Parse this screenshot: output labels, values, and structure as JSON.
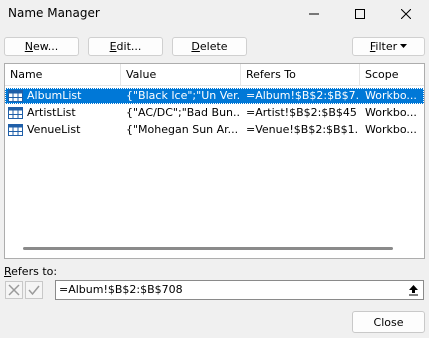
{
  "window": {
    "title": "Name Manager",
    "controls": [
      "minimize-icon",
      "maximize-icon",
      "close-icon"
    ]
  },
  "toolbar": {
    "new_label_u": "N",
    "new_label_rest": "ew...",
    "edit_label_u": "E",
    "edit_label_rest": "dit...",
    "delete_label_u": "D",
    "delete_label_rest": "elete",
    "filter_label_u": "F",
    "filter_label_rest": "ilter"
  },
  "table": {
    "columns": [
      "Name",
      "Value",
      "Refers To",
      "Scope"
    ],
    "rows": [
      {
        "name": "AlbumList",
        "value": "{\"Black Ice\";\"Un Ver...",
        "refers_to": "=Album!$B$2:$B$7...",
        "scope": "Workbo...",
        "selected": true
      },
      {
        "name": "ArtistList",
        "value": "{\"AC/DC\";\"Bad Bun...",
        "refers_to": "=Artist!$B$2:$B$45",
        "scope": "Workbo...",
        "selected": false
      },
      {
        "name": "VenueList",
        "value": "{\"Mohegan Sun Ar...",
        "refers_to": "=Venue!$B$2:$B$1...",
        "scope": "Workbo...",
        "selected": false
      }
    ]
  },
  "refers_to": {
    "label_u": "R",
    "label_rest": "efers to:",
    "value": "=Album!$B$2:$B$708"
  },
  "footer": {
    "close_label": "Close"
  },
  "colors": {
    "selection": "#0078d7",
    "background": "#f0f0f0"
  }
}
